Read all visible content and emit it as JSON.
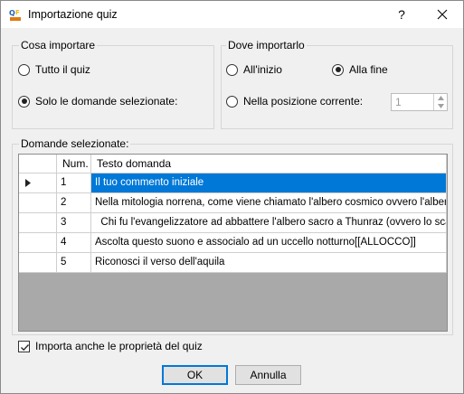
{
  "window": {
    "title": "Importazione quiz",
    "help_label": "?"
  },
  "what_group": {
    "label": "Cosa importare",
    "options": [
      {
        "label": "Tutto il quiz",
        "selected": false
      },
      {
        "label": "Solo le domande selezionate:",
        "selected": true
      }
    ]
  },
  "where_group": {
    "label": "Dove importarlo",
    "options": [
      {
        "label": "All'inizio",
        "selected": false
      },
      {
        "label": "Alla fine",
        "selected": true
      },
      {
        "label": "Nella posizione corrente:",
        "selected": false
      }
    ],
    "position_value": "1"
  },
  "questions_group": {
    "label": "Domande selezionate:",
    "columns": [
      "Num.",
      "Testo domanda"
    ],
    "rows": [
      {
        "num": "1",
        "text": "Il tuo commento iniziale",
        "selected": true
      },
      {
        "num": "2",
        "text": "Nella mitologia norrena, come viene chiamato l'albero cosmico ovvero l'albero d...",
        "selected": false
      },
      {
        "num": "3",
        "text": "  Chi fu l'evangelizzatore ad abbattere l'albero sacro a Thunraz (ovvero lo scand...",
        "selected": false
      },
      {
        "num": "4",
        "text": "Ascolta questo suono e associalo ad un uccello notturno[[ALLOCCO]]",
        "selected": false
      },
      {
        "num": "5",
        "text": "Riconosci il verso dell'aquila",
        "selected": false
      }
    ]
  },
  "import_properties": {
    "label": "Importa anche le proprietà del quiz",
    "checked": true
  },
  "buttons": {
    "ok": "OK",
    "cancel": "Annulla"
  },
  "colors": {
    "selection": "#0078d7",
    "grid_empty": "#a9a9a9",
    "dialog_bg": "#f0f0f0"
  },
  "icons": {
    "app": "quiz-faber-icon",
    "close": "close-icon",
    "row_pointer": "row-pointer-icon"
  }
}
